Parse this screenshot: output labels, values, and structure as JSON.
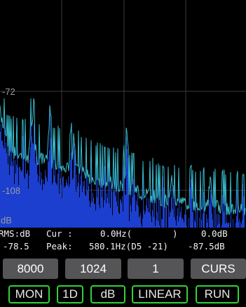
{
  "spectrum": {
    "y_labels": [
      "-72",
      "-108",
      "dB"
    ],
    "grid_color": "#3a3a3a",
    "trace_color": "#38b9c9",
    "fill_color": "#1c3fd0"
  },
  "readout": {
    "units_label": "RMS:dB",
    "rms_value": "-78.5",
    "cursor_label": "Cur :",
    "cursor_freq": "0.0Hz(",
    "cursor_note_close": ")",
    "cursor_db": "0.0dB",
    "peak_label": "Peak:",
    "peak_freq": "580.1Hz(D5 -21)",
    "peak_db": "-87.5dB"
  },
  "buttons": {
    "sample_rate": "8000",
    "fft_size": "1024",
    "average": "1",
    "cursor": "CURS"
  },
  "toggles": {
    "monitor": "MON",
    "mode": "1D",
    "scale": "dB",
    "axis": "LINEAR",
    "run": "RUN"
  },
  "colors": {
    "button_bg": "#555557",
    "toggle_border": "#2fd23a"
  }
}
